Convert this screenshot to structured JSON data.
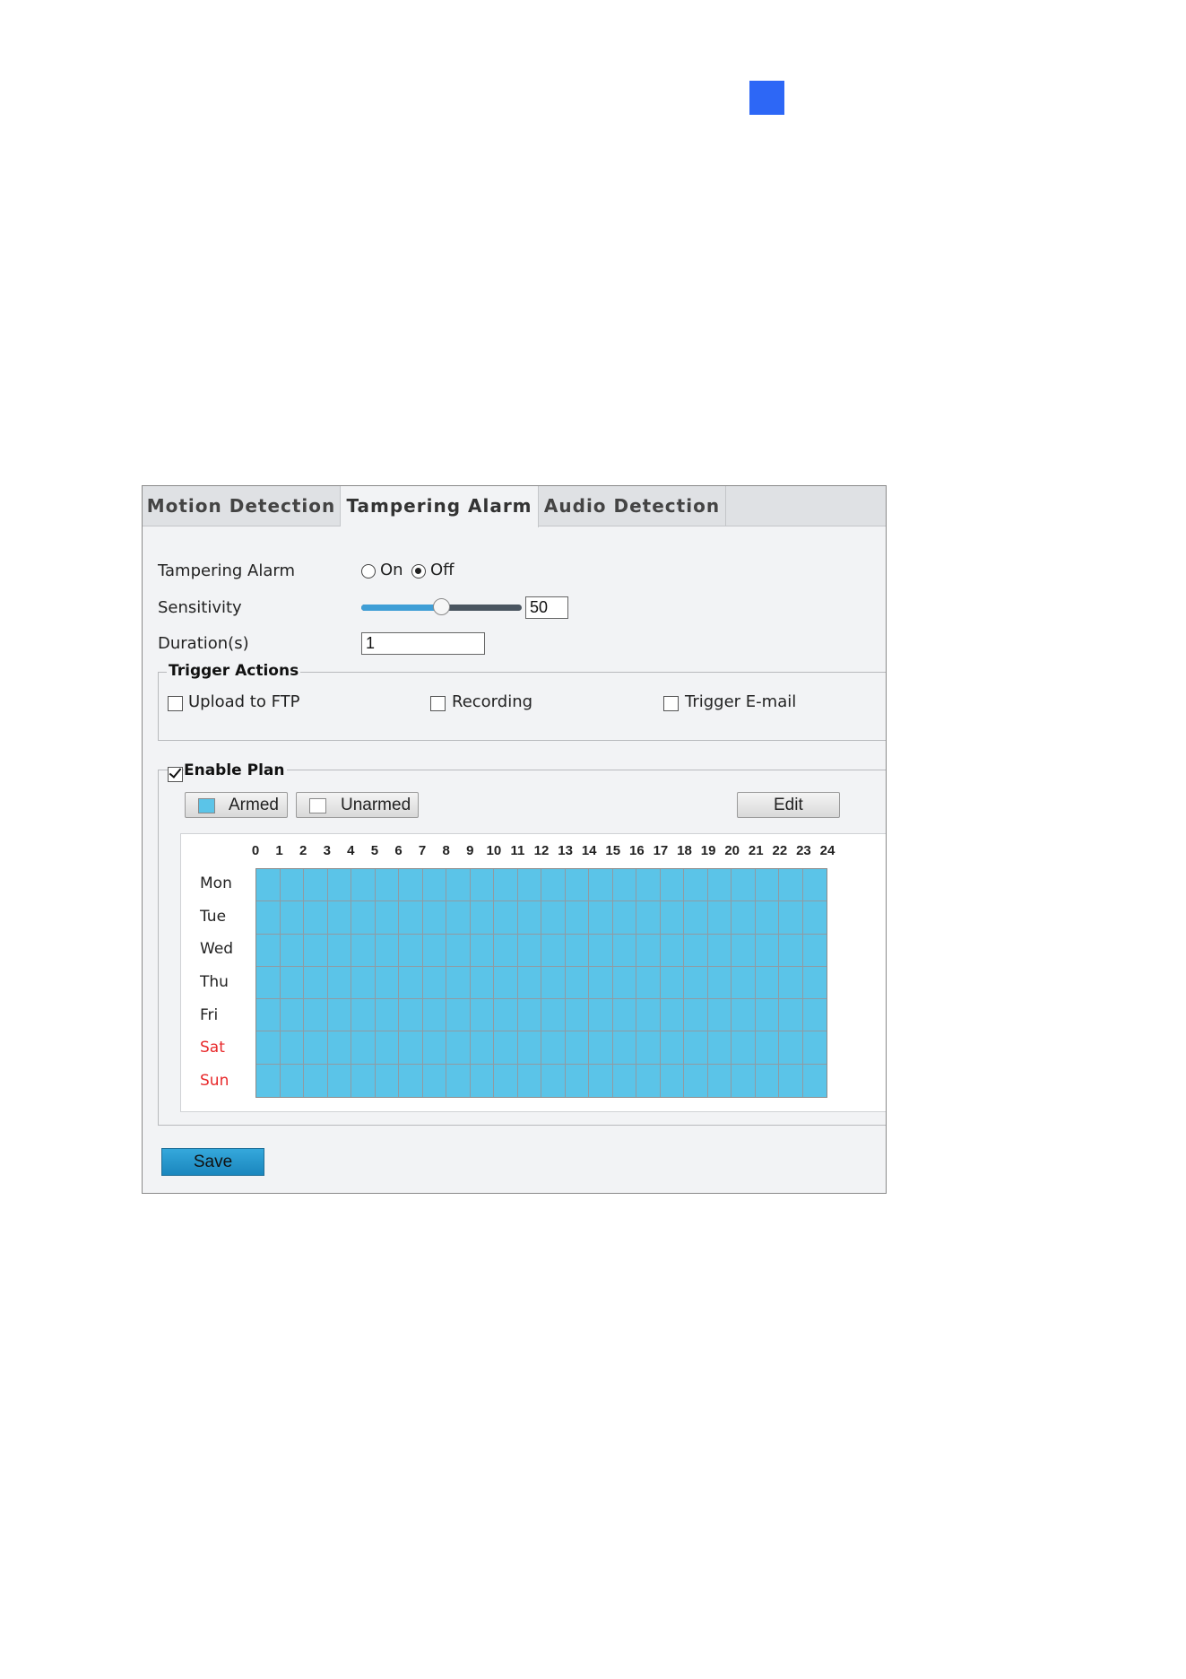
{
  "tabs": [
    {
      "label": "Motion Detection",
      "active": false
    },
    {
      "label": "Tampering Alarm",
      "active": true
    },
    {
      "label": "Audio Detection",
      "active": false
    }
  ],
  "form": {
    "tampering_alarm_label": "Tampering Alarm",
    "on_label": "On",
    "off_label": "Off",
    "alarm_state": "Off",
    "sensitivity_label": "Sensitivity",
    "sensitivity_value": "50",
    "sensitivity_fraction": 0.5,
    "duration_label": "Duration(s)",
    "duration_value": "1"
  },
  "trigger_actions": {
    "title": "Trigger Actions",
    "options": [
      {
        "label": "Upload to FTP",
        "checked": false
      },
      {
        "label": "Recording",
        "checked": false
      },
      {
        "label": "Trigger E-mail",
        "checked": false
      }
    ]
  },
  "plan": {
    "title": "Enable Plan",
    "enabled": true,
    "armed_label": "Armed",
    "unarmed_label": "Unarmed",
    "edit_label": "Edit",
    "hours": [
      "0",
      "1",
      "2",
      "3",
      "4",
      "5",
      "6",
      "7",
      "8",
      "9",
      "10",
      "11",
      "12",
      "13",
      "14",
      "15",
      "16",
      "17",
      "18",
      "19",
      "20",
      "21",
      "22",
      "23",
      "24"
    ],
    "days": [
      {
        "label": "Mon",
        "weekend": false
      },
      {
        "label": "Tue",
        "weekend": false
      },
      {
        "label": "Wed",
        "weekend": false
      },
      {
        "label": "Thu",
        "weekend": false
      },
      {
        "label": "Fri",
        "weekend": false
      },
      {
        "label": "Sat",
        "weekend": true
      },
      {
        "label": "Sun",
        "weekend": true
      }
    ]
  },
  "save_label": "Save",
  "colors": {
    "armed": "#5bc4e8",
    "unarmed": "#ffffff",
    "weekend_text": "#e8292b",
    "weekday_text": "#222222",
    "accent": "#2d67f6"
  }
}
